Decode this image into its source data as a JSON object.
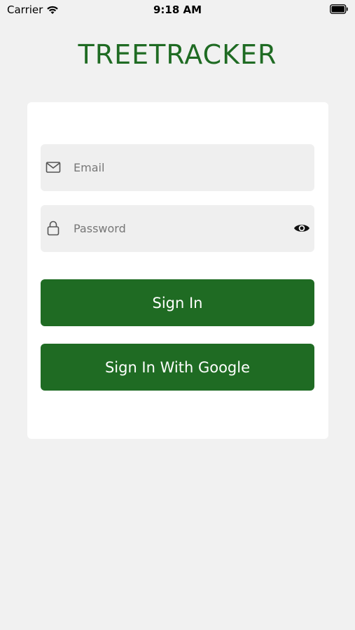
{
  "status_bar": {
    "carrier": "Carrier",
    "time": "9:18 AM"
  },
  "app": {
    "title": "TREETRACKER",
    "brand_color": "#1f6b23"
  },
  "form": {
    "email": {
      "placeholder": "Email",
      "value": "",
      "icon": "mail-icon"
    },
    "password": {
      "placeholder": "Password",
      "value": "",
      "icon": "lock-icon",
      "toggle_icon": "eye-icon"
    },
    "sign_in_label": "Sign In",
    "google_sign_in_label": "Sign In With Google"
  }
}
